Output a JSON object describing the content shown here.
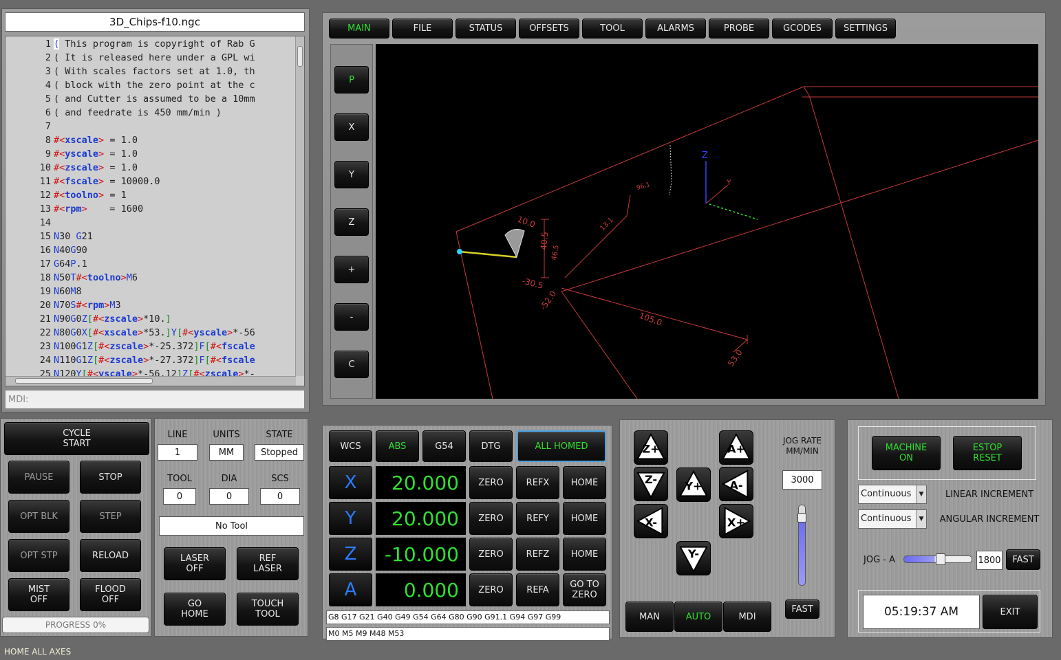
{
  "editor": {
    "filename": "3D_Chips-f10.ngc",
    "mdi_label": "MDI:",
    "lines": [
      {
        "n": "1",
        "html": "<span style='background:#fff;color:#1a3ad0'>(</span> This program is copyright of Rab G"
      },
      {
        "n": "2",
        "html": "( It is released here under a GPL wi"
      },
      {
        "n": "3",
        "html": "( With scales factors set at 1.0, th"
      },
      {
        "n": "4",
        "html": "( block with the zero point at the c"
      },
      {
        "n": "5",
        "html": "( and Cutter is assumed to be a 10mm"
      },
      {
        "n": "6",
        "html": "( and feedrate is 450 mm/min )"
      },
      {
        "n": "7",
        "html": ""
      },
      {
        "n": "8",
        "html": "<span class='r'>#&lt;</span><span class='b'>xscale</span><span class='r'>&gt;</span> = 1.0"
      },
      {
        "n": "9",
        "html": "<span class='r'>#&lt;</span><span class='b'>yscale</span><span class='r'>&gt;</span> = 1.0"
      },
      {
        "n": "10",
        "html": "<span class='r'>#&lt;</span><span class='b'>zscale</span><span class='r'>&gt;</span> = 1.0"
      },
      {
        "n": "11",
        "html": "<span class='r'>#&lt;</span><span class='b'>fscale</span><span class='r'>&gt;</span> = 10000.0"
      },
      {
        "n": "12",
        "html": "<span class='r'>#&lt;</span><span class='b'>toolno</span><span class='r'>&gt;</span> = 1"
      },
      {
        "n": "13",
        "html": "<span class='r'>#&lt;</span><span class='b'>rpm</span><span class='r'>&gt;</span>    = 1600"
      },
      {
        "n": "14",
        "html": ""
      },
      {
        "n": "15",
        "html": "<span class='bl'>N</span>30 <span class='bl'>G</span>21"
      },
      {
        "n": "16",
        "html": "<span class='bl'>N</span>40<span class='bl'>G</span>90"
      },
      {
        "n": "17",
        "html": "<span class='bl'>G</span>64<span class='bl'>P</span>.1"
      },
      {
        "n": "18",
        "html": "<span class='bl'>N</span>50<span class='bl'>T</span><span class='r'>#&lt;</span><span class='b'>toolno</span><span class='r'>&gt;</span><span class='bl'>M</span>6"
      },
      {
        "n": "19",
        "html": "<span class='bl'>N</span>60<span class='bl'>M</span>8"
      },
      {
        "n": "20",
        "html": "<span class='bl'>N</span>70<span class='bl'>S</span><span class='r'>#&lt;</span><span class='b'>rpm</span><span class='r'>&gt;</span><span class='bl'>M</span>3"
      },
      {
        "n": "21",
        "html": "<span class='bl'>N</span>90<span class='bl'>G</span>0<span class='bl'>Z</span><span class='g'>[</span><span class='r'>#&lt;</span><span class='b'>zscale</span><span class='r'>&gt;</span>*10.<span class='g'>]</span>"
      },
      {
        "n": "22",
        "html": "<span class='bl'>N</span>80<span class='bl'>G</span>0<span class='bl'>X</span><span class='g'>[</span><span class='r'>#&lt;</span><span class='b'>xscale</span><span class='r'>&gt;</span>*53.<span class='g'>]</span><span class='bl'>Y</span><span class='g'>[</span><span class='r'>#&lt;</span><span class='b'>yscale</span><span class='r'>&gt;</span>*-56"
      },
      {
        "n": "23",
        "html": "<span class='bl'>N</span>100<span class='bl'>G</span>1<span class='bl'>Z</span><span class='g'>[</span><span class='r'>#&lt;</span><span class='b'>zscale</span><span class='r'>&gt;</span>*-25.372<span class='g'>]</span><span class='bl'>F</span><span class='g'>[</span><span class='r'>#&lt;</span><span class='b'>fscale</span>"
      },
      {
        "n": "24",
        "html": "<span class='bl'>N</span>110<span class='bl'>G</span>1<span class='bl'>Z</span><span class='g'>[</span><span class='r'>#&lt;</span><span class='b'>zscale</span><span class='r'>&gt;</span>*-27.372<span class='g'>]</span><span class='bl'>F</span><span class='g'>[</span><span class='r'>#&lt;</span><span class='b'>fscale</span>"
      },
      {
        "n": "25",
        "html": "<span class='bl'>N</span>120<span class='bl'>Y</span><span class='g'>[</span><span class='r'>#&lt;</span><span class='b'>yscale</span><span class='r'>&gt;</span>*-56.12<span class='g'>]</span><span class='bl'>Z</span><span class='g'>[</span><span class='r'>#&lt;</span><span class='b'>zscale</span><span class='r'>&gt;</span>*-"
      }
    ]
  },
  "tabs": [
    "MAIN",
    "FILE",
    "STATUS",
    "OFFSETS",
    "TOOL",
    "ALARMS",
    "PROBE",
    "GCODES",
    "SETTINGS"
  ],
  "view_buttons": [
    "P",
    "X",
    "Y",
    "Z",
    "+",
    "-",
    "C"
  ],
  "plot": {
    "labels": {
      "z_axis": "Z",
      "y_axis": "Y",
      "dim_10": "10.0",
      "dim_405": "40.5",
      "dim_neg305": "-30.5",
      "dim_neg52": "-52.0",
      "dim_105": "105.0",
      "dim_53": "53.0",
      "dim_131": "13.1",
      "dim_961": "96.1",
      "dim_465": "46.5"
    }
  },
  "cycle": {
    "cycle_start": "CYCLE\nSTART",
    "pause": "PAUSE",
    "stop": "STOP",
    "opt_blk": "OPT BLK",
    "step": "STEP",
    "opt_stp": "OPT STP",
    "reload": "RELOAD",
    "mist": "MIST\nOFF",
    "flood": "FLOOD\nOFF",
    "progress": "PROGRESS 0%"
  },
  "status": {
    "line_label": "LINE",
    "units_label": "UNITS",
    "state_label": "STATE",
    "line": "1",
    "units": "MM",
    "state": "Stopped",
    "tool_label": "TOOL",
    "dia_label": "DIA",
    "scs_label": "SCS",
    "tool": "0",
    "dia": "0",
    "scs": "0",
    "tool_name": "No Tool",
    "laser": "LASER\nOFF",
    "ref_laser": "REF\nLASER",
    "go_home": "GO\nHOME",
    "touch_tool": "TOUCH\nTOOL"
  },
  "dro": {
    "wcs": "WCS",
    "abs": "ABS",
    "g54": "G54",
    "dtg": "DTG",
    "all_homed": "ALL HOMED",
    "axes": [
      {
        "name": "X",
        "value": "20.000",
        "zero": "ZERO",
        "ref": "REFX",
        "home": "HOME"
      },
      {
        "name": "Y",
        "value": "20.000",
        "zero": "ZERO",
        "ref": "REFY",
        "home": "HOME"
      },
      {
        "name": "Z",
        "value": "-10.000",
        "zero": "ZERO",
        "ref": "REFZ",
        "home": "HOME"
      },
      {
        "name": "A",
        "value": "0.000",
        "zero": "ZERO",
        "ref": "REFA",
        "home": "GO TO\nZERO"
      }
    ],
    "gcodes": "G8 G17 G21 G40 G49 G54 G64 G80 G90 G91.1 G94 G97 G99",
    "mcodes": "M0 M5 M9 M48 M53"
  },
  "jog": {
    "rate_label": "JOG RATE\nMM/MIN",
    "rate": "3000",
    "fast": "FAST",
    "man": "MAN",
    "auto": "AUTO",
    "mdi": "MDI",
    "keys": {
      "zp": "Z+",
      "zm": "Z-",
      "ap": "A+",
      "am": "A-",
      "yp": "Y+",
      "ym": "Y-",
      "xp": "X+",
      "xm": "X-"
    }
  },
  "machine": {
    "machine_on": "MACHINE\nON",
    "estop": "ESTOP\nRESET",
    "linear_sel": "Continuous",
    "linear_label": "LINEAR INCREMENT",
    "angular_sel": "Continuous",
    "angular_label": "ANGULAR INCREMENT",
    "jog_a_label": "JOG - A",
    "jog_a_value": "1800",
    "jog_a_fast": "FAST",
    "jog_a_level": 0.45,
    "clock": "05:19:37 AM",
    "exit": "EXIT"
  },
  "statusbar": "HOME ALL AXES"
}
